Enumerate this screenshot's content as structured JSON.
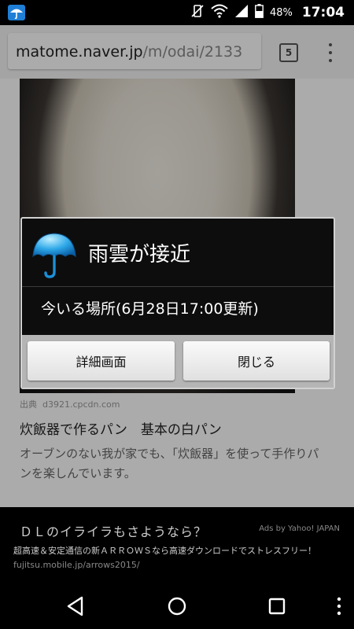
{
  "status_bar": {
    "battery_percent": "48%",
    "time": "17:04"
  },
  "browser": {
    "url_host": "matome.naver.jp",
    "url_path": "/m/odai/2133",
    "tab_count": "5"
  },
  "article": {
    "source_label": "出典",
    "source_domain": "d3921.cpcdn.com",
    "title": "炊飯器で作るパン　基本の白パン",
    "description": "オーブンのない我が家でも、「炊飯器」を使って手作りパンを楽しんでいます。"
  },
  "dialog": {
    "title": "雨雲が接近",
    "message": "今いる場所(6月28日17:00更新)",
    "details_button": "詳細画面",
    "close_button": "閉じる"
  },
  "ad": {
    "headline": "ＤＬのイライラもさようなら？",
    "ads_by": "Ads by Yahoo! JAPAN",
    "body": "超高速＆安定通信の新ＡＲＲＯＷＳなら高速ダウンロードでストレスフリー！",
    "url": "fujitsu.mobile.jp/arrows2015/"
  }
}
